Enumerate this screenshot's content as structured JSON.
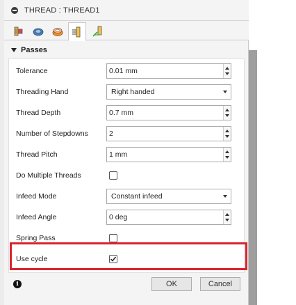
{
  "title": "THREAD : THREAD1",
  "tabs": [
    {
      "name": "tool-tab",
      "icon": "tool-icon"
    },
    {
      "name": "geometry-tab",
      "icon": "geometry-icon"
    },
    {
      "name": "heights-tab",
      "icon": "heights-icon"
    },
    {
      "name": "passes-tab",
      "icon": "passes-icon",
      "active": true
    },
    {
      "name": "linking-tab",
      "icon": "linking-icon"
    }
  ],
  "section": {
    "title": "Passes",
    "expanded": true
  },
  "fields": {
    "tolerance": {
      "label": "Tolerance",
      "value": "0.01 mm"
    },
    "threading_hand": {
      "label": "Threading Hand",
      "value": "Right handed"
    },
    "thread_depth": {
      "label": "Thread Depth",
      "value": "0.7 mm"
    },
    "stepdowns": {
      "label": "Number of Stepdowns",
      "value": "2"
    },
    "thread_pitch": {
      "label": "Thread Pitch",
      "value": "1 mm"
    },
    "multiple_threads": {
      "label": "Do Multiple Threads",
      "checked": false
    },
    "infeed_mode": {
      "label": "Infeed Mode",
      "value": "Constant infeed"
    },
    "infeed_angle": {
      "label": "Infeed Angle",
      "value": "0 deg"
    },
    "spring_pass": {
      "label": "Spring Pass",
      "checked": false
    },
    "use_cycle": {
      "label": "Use cycle",
      "checked": true
    }
  },
  "footer": {
    "info_symbol": "i",
    "ok_label": "OK",
    "cancel_label": "Cancel"
  },
  "colors": {
    "highlight": "#d9232b",
    "accent_green": "#3aa936",
    "accent_orange": "#e8912e"
  }
}
